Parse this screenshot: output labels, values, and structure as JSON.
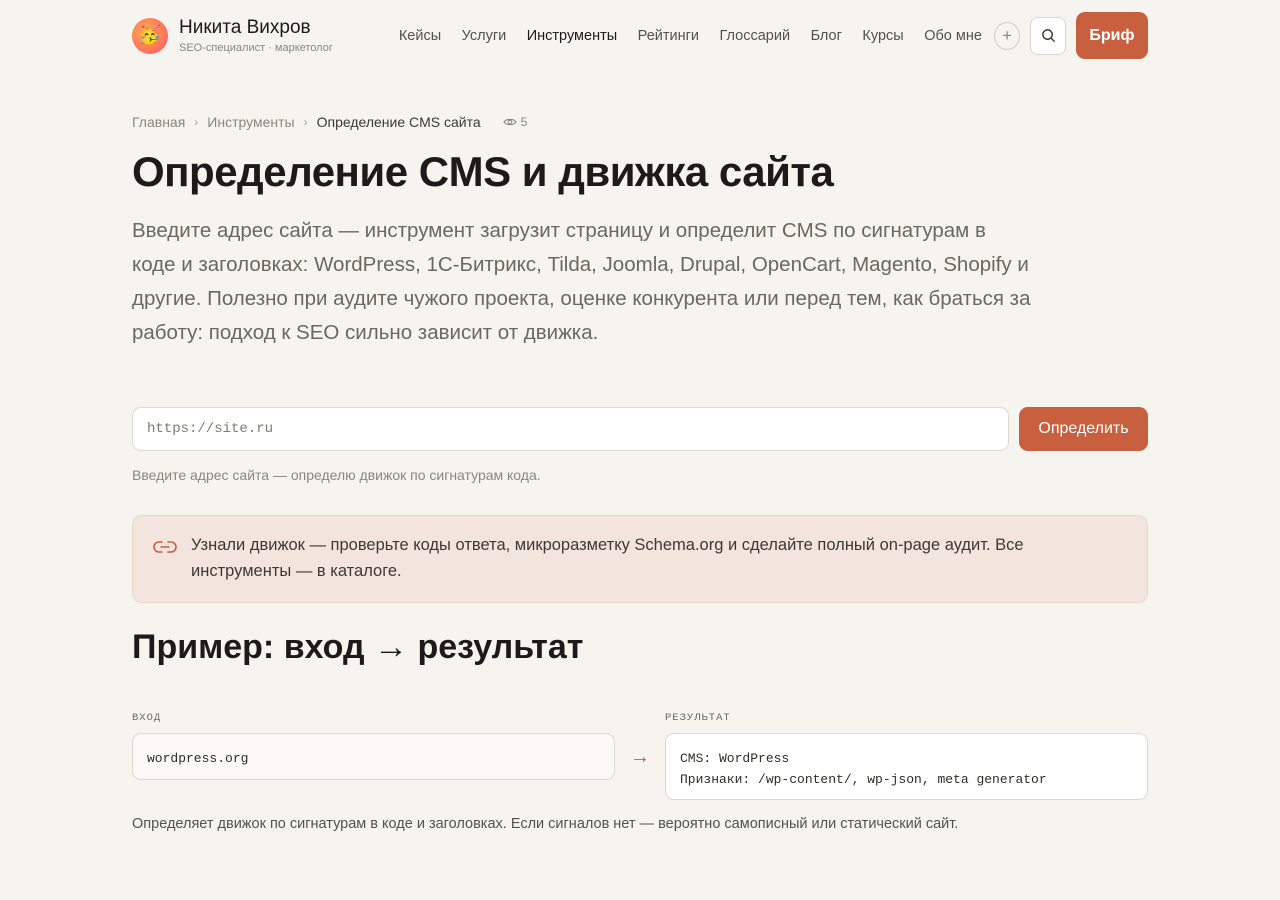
{
  "header": {
    "brand_name": "Никита Вихров",
    "brand_sub": "SEO-специалист · маркетолог",
    "nav": [
      {
        "label": "Кейсы",
        "active": false
      },
      {
        "label": "Услуги",
        "active": false
      },
      {
        "label": "Инструменты",
        "active": true
      },
      {
        "label": "Рейтинги",
        "active": false
      },
      {
        "label": "Глоссарий",
        "active": false
      },
      {
        "label": "Блог",
        "active": false
      },
      {
        "label": "Курсы",
        "active": false
      },
      {
        "label": "Обо мне",
        "active": false
      }
    ],
    "plus_label": "+",
    "brief_label": "Бриф"
  },
  "breadcrumbs": {
    "home": "Главная",
    "section": "Инструменты",
    "current": "Определение CMS сайта",
    "views": "5"
  },
  "page": {
    "title": "Определение CMS и движка сайта",
    "lead": "Введите адрес сайта — инструмент загрузит страницу и определит CMS по сигнатурам в коде и заголовках: WordPress, 1С-Битрикс, Tilda, Joomla, Drupal, OpenCart, Magento, Shopify и другие. Полезно при аудите чужого проекта, оценке конкурента или перед тем, как браться за работу: подход к SEO сильно зависит от движка."
  },
  "form": {
    "url_value": "",
    "url_placeholder": "https://site.ru",
    "submit_label": "Определить",
    "hint": "Введите адрес сайта — определю движок по сигнатурам кода."
  },
  "callout": {
    "text": "Узнали движок — проверьте коды ответа, микроразметку Schema.org и сделайте полный on-page аудит. Все инструменты — в каталоге."
  },
  "example": {
    "heading": "Пример: вход → результат",
    "input_label": "ВХОД",
    "input_value": "wordpress.org",
    "output_label": "РЕЗУЛЬТАТ",
    "output_line1": "CMS: WordPress",
    "output_line2": "Признаки: /wp-content/, wp-json, meta generator",
    "arrow": "→",
    "note": "Определяет движок по сигнатурам в коде и заголовках. Если сигналов нет — вероятно самописный или статический сайт."
  },
  "colors": {
    "accent": "#c8603f",
    "background": "#f5f4ee",
    "callout_bg": "#f3e5dd"
  }
}
